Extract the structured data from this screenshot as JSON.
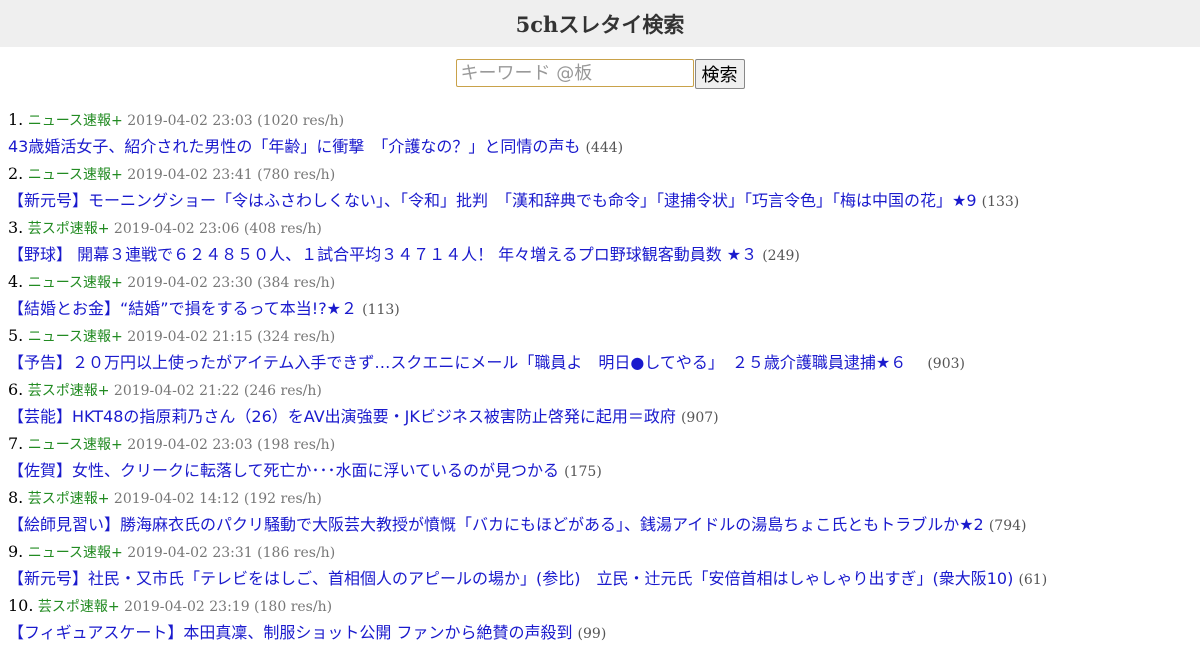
{
  "header": {
    "title": "5chスレタイ検索"
  },
  "search": {
    "placeholder": "キーワード @板",
    "button_label": "検索"
  },
  "results": [
    {
      "rank": "1.",
      "board": "ニュース速報+",
      "meta": "2019-04-02 23:03 (1020 res/h)",
      "title": "43歳婚活女子、紹介された男性の「年齢」に衝撃　「介護なの？」と同情の声も",
      "count": "(444)"
    },
    {
      "rank": "2.",
      "board": "ニュース速報+",
      "meta": "2019-04-02 23:41 (780 res/h)",
      "title": "【新元号】モーニングショー「令はふさわしくない」、「令和」批判　「漢和辞典でも命令」「逮捕令状」「巧言令色」「梅は中国の花」★9",
      "count": "(133)"
    },
    {
      "rank": "3.",
      "board": "芸スポ速報+",
      "meta": "2019-04-02 23:06 (408 res/h)",
      "title": "【野球】 開幕３連戦で６２４８５０人、１試合平均３４７１４人！ 年々増えるプロ野球観客動員数 ★３",
      "count": "(249)"
    },
    {
      "rank": "4.",
      "board": "ニュース速報+",
      "meta": "2019-04-02 23:30 (384 res/h)",
      "title": "【結婚とお金】“結婚”で損をするって本当!?★２",
      "count": "(113)"
    },
    {
      "rank": "5.",
      "board": "ニュース速報+",
      "meta": "2019-04-02 21:15 (324 res/h)",
      "title": "【予告】２０万円以上使ったがアイテム入手できず…スクエニにメール「職員よ　明日●してやる」　２５歳介護職員逮捕★６　",
      "count": "(903)"
    },
    {
      "rank": "6.",
      "board": "芸スポ速報+",
      "meta": "2019-04-02 21:22 (246 res/h)",
      "title": "【芸能】HKT48の指原莉乃さん（26）をAV出演強要・JKビジネス被害防止啓発に起用＝政府",
      "count": "(907)"
    },
    {
      "rank": "7.",
      "board": "ニュース速報+",
      "meta": "2019-04-02 23:03 (198 res/h)",
      "title": "【佐賀】女性、クリークに転落して死亡か･･･水面に浮いているのが見つかる",
      "count": "(175)"
    },
    {
      "rank": "8.",
      "board": "芸スポ速報+",
      "meta": "2019-04-02 14:12 (192 res/h)",
      "title": "【絵師見習い】勝海麻衣氏のパクリ騒動で大阪芸大教授が憤慨「バカにもほどがある」、銭湯アイドルの湯島ちょこ氏ともトラブルか★2",
      "count": "(794)"
    },
    {
      "rank": "9.",
      "board": "ニュース速報+",
      "meta": "2019-04-02 23:31 (186 res/h)",
      "title": "【新元号】社民・又市氏「テレビをはしご、首相個人のアピールの場か」(参比)　立民・辻元氏「安倍首相はしゃしゃり出すぎ」(衆大阪10)",
      "count": "(61)"
    },
    {
      "rank": "10.",
      "board": "芸スポ速報+",
      "meta": "2019-04-02 23:19 (180 res/h)",
      "title": "【フィギュアスケート】本田真凜、制服ショット公開 ファンから絶賛の声殺到",
      "count": "(99)"
    }
  ]
}
